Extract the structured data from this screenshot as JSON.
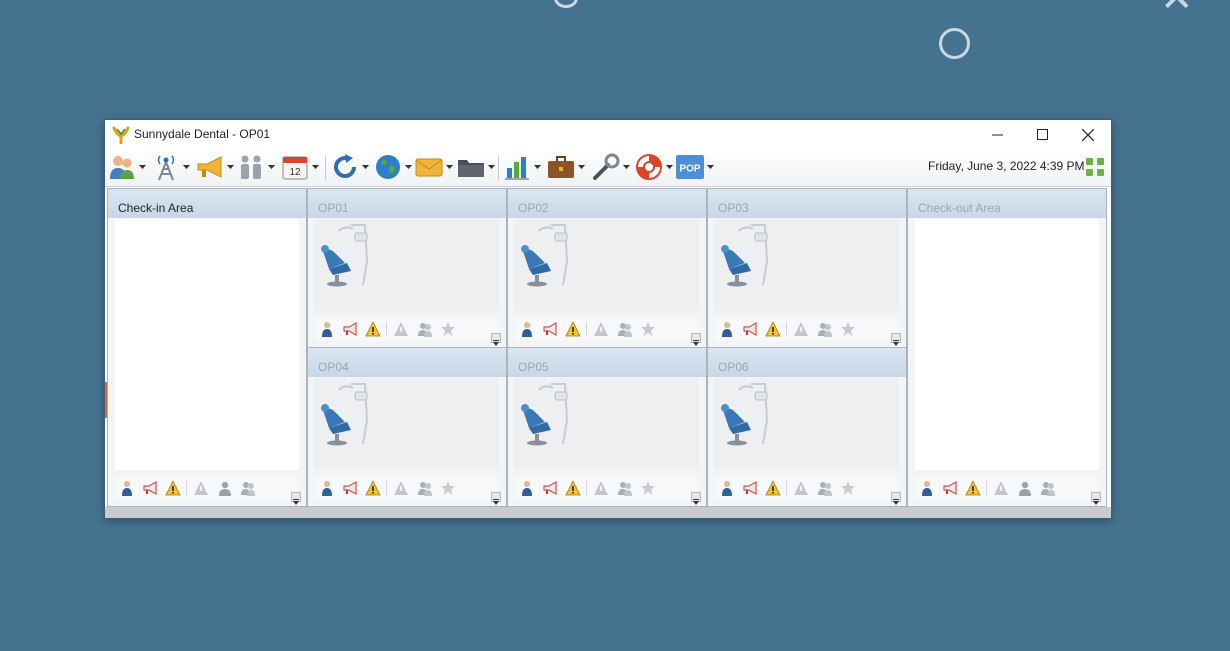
{
  "window": {
    "title": "Sunnydale Dental - OP01",
    "controls": [
      "minimize",
      "maximize",
      "close"
    ]
  },
  "toolbar": {
    "buttons": [
      {
        "icon": "patients-icon"
      },
      {
        "icon": "radio-tower-icon"
      },
      {
        "icon": "megaphone-icon"
      },
      {
        "icon": "family-icon"
      },
      {
        "icon": "calendar-icon",
        "text": "12"
      },
      {
        "icon": "refresh-icon"
      },
      {
        "icon": "globe-icon"
      },
      {
        "icon": "mail-icon"
      },
      {
        "icon": "folder-icon"
      },
      {
        "icon": "chart-icon"
      },
      {
        "icon": "briefcase-icon"
      },
      {
        "icon": "tools-icon"
      },
      {
        "icon": "lifebuoy-icon"
      },
      {
        "icon": "pop-icon",
        "text": "POP"
      }
    ],
    "datetime": "Friday, June 3, 2022 4:39 PM"
  },
  "board": {
    "checkin": {
      "label": "Check-in Area"
    },
    "checkout": {
      "label": "Check-out Area"
    },
    "operatories": [
      {
        "label": "OP01"
      },
      {
        "label": "OP02"
      },
      {
        "label": "OP03"
      },
      {
        "label": "OP04"
      },
      {
        "label": "OP05"
      },
      {
        "label": "OP06"
      }
    ],
    "status_icons": [
      "patient-icon",
      "megaphone-icon",
      "warning-icon",
      "alert-gray-icon",
      "person-gray-icon",
      "team-gray-icon",
      "star-icon"
    ]
  },
  "colors": {
    "desktop": "#44728f",
    "panel_header": "#d3dfec",
    "active_marker": "#e8632b"
  }
}
